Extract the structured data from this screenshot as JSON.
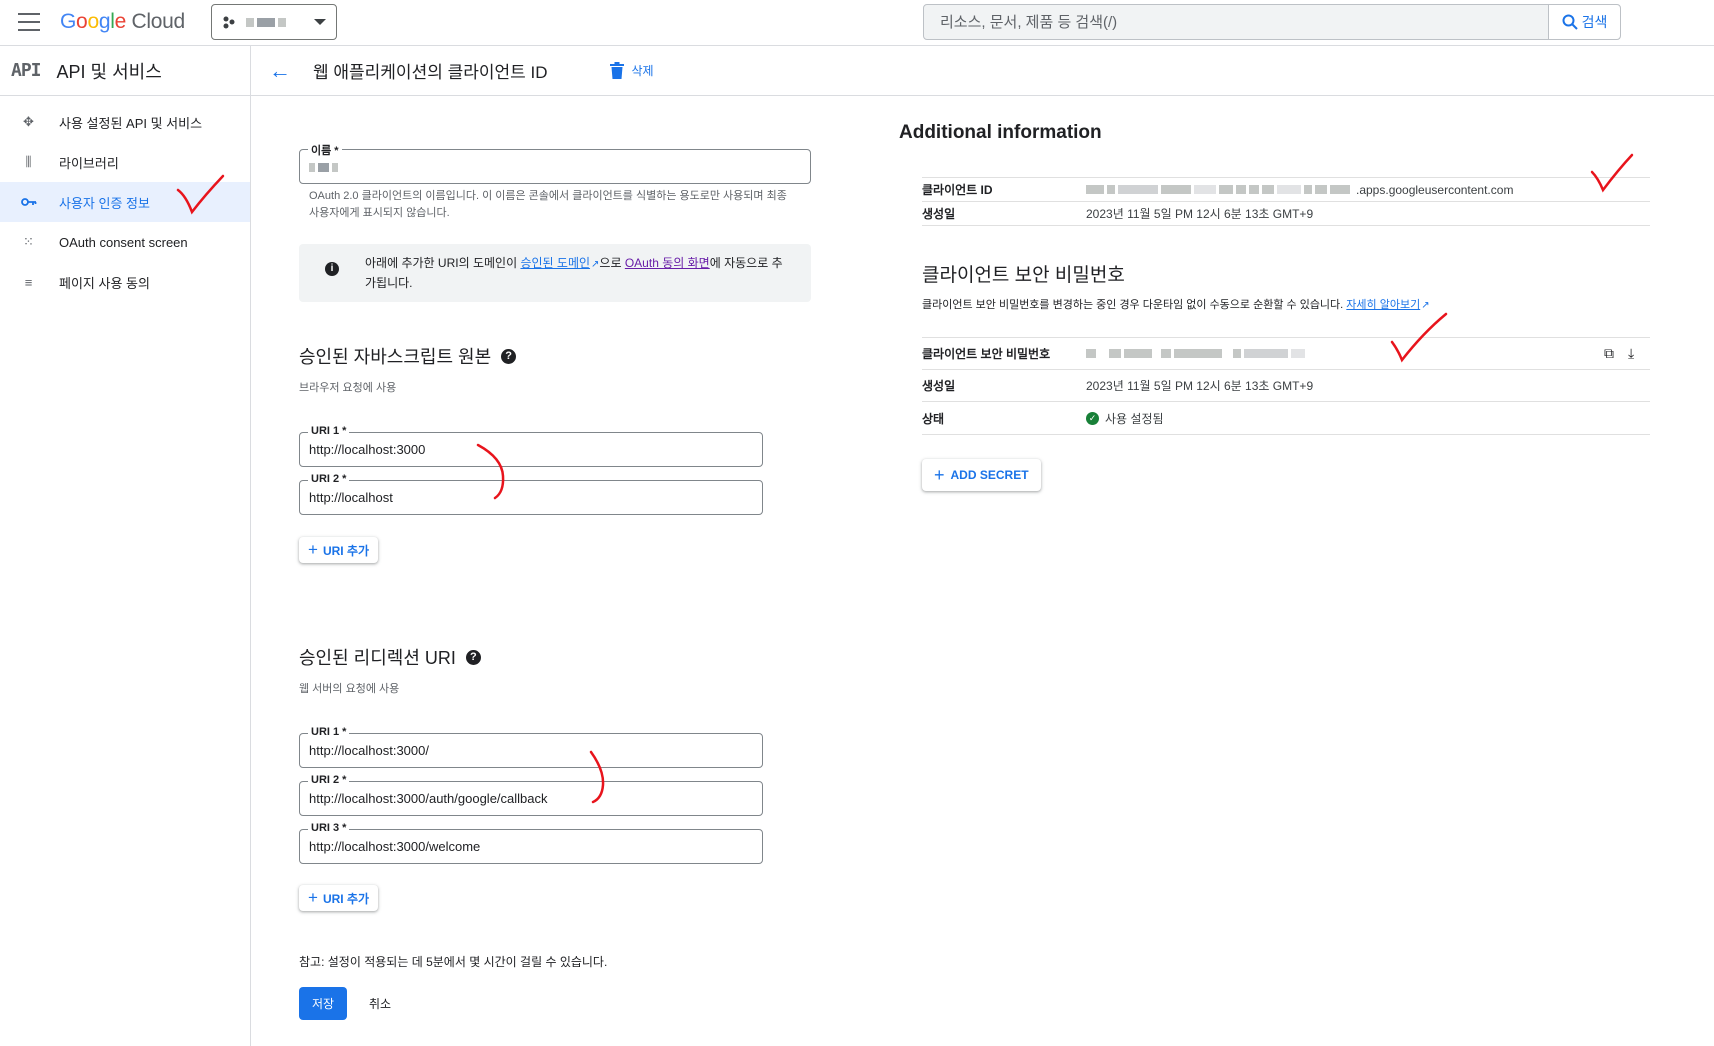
{
  "header": {
    "logo_parts": [
      "G",
      "o",
      "o",
      "g",
      "l",
      "e"
    ],
    "logo_cloud": "Cloud",
    "search_placeholder": "리소스, 문서, 제품 등 검색(/)",
    "search_button": "검색"
  },
  "sidebar": {
    "api_mark": "API",
    "title": "API 및 서비스",
    "items": [
      {
        "label": "사용 설정된 API 및 서비스",
        "icon": "api-services-icon",
        "active": false
      },
      {
        "label": "라이브러리",
        "icon": "library-icon",
        "active": false
      },
      {
        "label": "사용자 인증 정보",
        "icon": "key-icon",
        "active": true
      },
      {
        "label": "OAuth consent screen",
        "icon": "consent-icon",
        "active": false
      },
      {
        "label": "페이지 사용 동의",
        "icon": "page-agreement-icon",
        "active": false
      }
    ]
  },
  "page": {
    "title": "웹 애플리케이션의 클라이언트 ID",
    "delete_label": "삭제"
  },
  "form": {
    "name_label": "이름 *",
    "name_hint": "OAuth 2.0 클라이언트의 이름입니다. 이 이름은 콘솔에서 클라이언트를 식별하는 용도로만 사용되며 최종 사용자에게 표시되지 않습니다.",
    "info_prefix": "아래에 추가한 URI의 도메인이 ",
    "info_link1": "승인된 도메인",
    "info_mid": "으로 ",
    "info_link2": "OAuth 동의 화면",
    "info_suffix": "에 자동으로 추가됩니다.",
    "js_origins": {
      "title": "승인된 자바스크립트 원본",
      "subtitle": "브라우저 요청에 사용",
      "uris": [
        {
          "label": "URI 1 *",
          "value": "http://localhost:3000"
        },
        {
          "label": "URI 2 *",
          "value": "http://localhost"
        }
      ],
      "add_label": "URI 추가"
    },
    "redirects": {
      "title": "승인된 리디렉션 URI",
      "subtitle": "웹 서버의 요청에 사용",
      "uris": [
        {
          "label": "URI 1 *",
          "value": "http://localhost:3000/"
        },
        {
          "label": "URI 2 *",
          "value": "http://localhost:3000/auth/google/callback"
        },
        {
          "label": "URI 3 *",
          "value": "http://localhost:3000/welcome"
        }
      ],
      "add_label": "URI 추가"
    },
    "note": "참고: 설정이 적용되는 데 5분에서 몇 시간이 걸릴 수 있습니다.",
    "save_label": "저장",
    "cancel_label": "취소"
  },
  "additional": {
    "title": "Additional information",
    "client_id_label": "클라이언트 ID",
    "client_id_suffix": ".apps.googleusercontent.com",
    "created_label": "생성일",
    "created_value": "2023년 11월 5일 PM 12시 6분 13초 GMT+9"
  },
  "secret": {
    "title": "클라이언트 보안 비밀번호",
    "desc": "클라이언트 보안 비밀번호를 변경하는 중인 경우 다운타임 없이 수동으로 순환할 수 있습니다. ",
    "learn_more": "자세히 알아보기",
    "secret_label": "클라이언트 보안 비밀번호",
    "created_label": "생성일",
    "created_value": "2023년 11월 5일 PM 12시 6분 13초 GMT+9",
    "status_label": "상태",
    "status_value": "사용 설정됨",
    "add_secret_label": "ADD SECRET"
  },
  "colors": {
    "accent": "#1a73e8",
    "annotation": "#e8141c"
  }
}
